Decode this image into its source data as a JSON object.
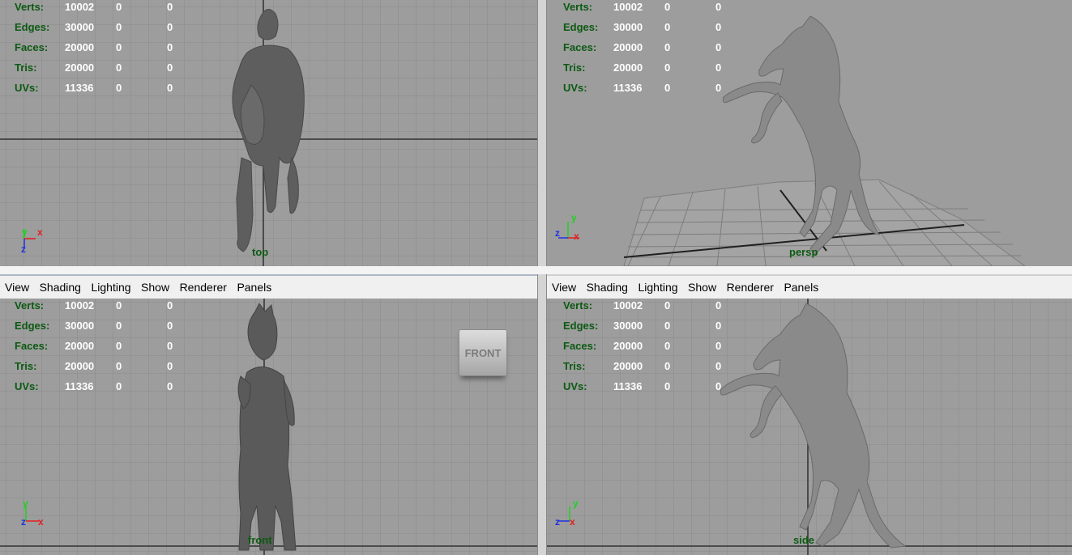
{
  "menu": [
    "View",
    "Shading",
    "Lighting",
    "Show",
    "Renderer",
    "Panels"
  ],
  "hud_labels": [
    "Verts:",
    "Edges:",
    "Faces:",
    "Tris:",
    "UVs:"
  ],
  "hud_values": [
    [
      "10002",
      "0",
      "0"
    ],
    [
      "30000",
      "0",
      "0"
    ],
    [
      "20000",
      "0",
      "0"
    ],
    [
      "20000",
      "0",
      "0"
    ],
    [
      "11336",
      "0",
      "0"
    ]
  ],
  "viewports": {
    "top": {
      "camera": "top"
    },
    "persp": {
      "camera": "persp"
    },
    "front": {
      "camera": "front",
      "viewcube": "FRONT"
    },
    "side": {
      "camera": "side"
    }
  },
  "axis_letters": {
    "x": "x",
    "y": "y",
    "z": "z"
  },
  "colors": {
    "viewport_bg": "#9d9d9d",
    "grid": "#8a8a8a",
    "grid_axis": "#303030",
    "hud_label": "#0c5a12",
    "hud_value": "#ffffff",
    "axis_x": "#e02020",
    "axis_y": "#20d020",
    "axis_z": "#2030e0",
    "model": "#5e5e5e"
  },
  "icons": [
    "axis-gizmo-icon",
    "viewcube-icon",
    "horse-model"
  ]
}
